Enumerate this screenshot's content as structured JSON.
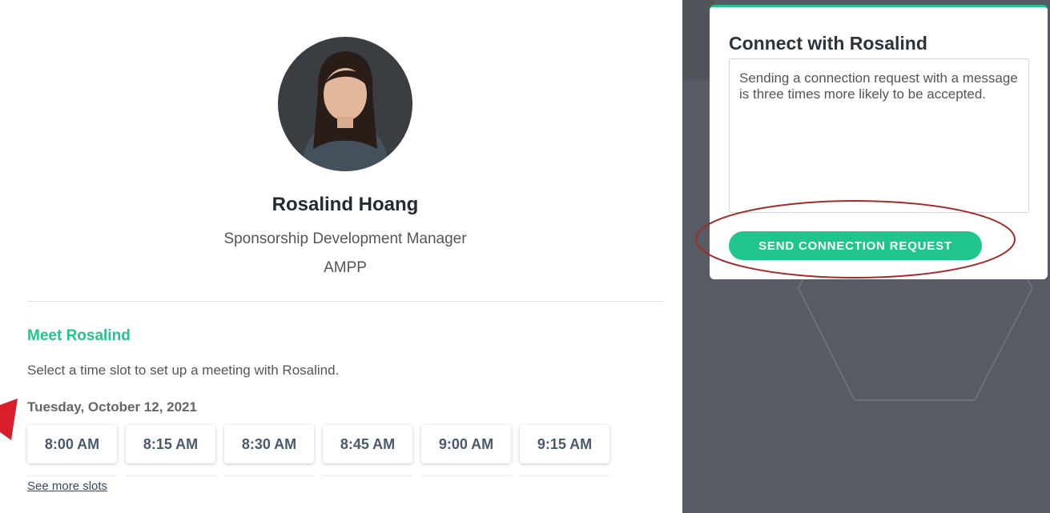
{
  "profile": {
    "name": "Rosalind Hoang",
    "job_title": "Sponsorship Development Manager",
    "company": "AMPP"
  },
  "meet": {
    "heading": "Meet Rosalind",
    "description": "Select a time slot to set up a meeting with Rosalind.",
    "date": "Tuesday, October 12, 2021",
    "slots": [
      "8:00 AM",
      "8:15 AM",
      "8:30 AM",
      "8:45 AM",
      "9:00 AM",
      "9:15 AM"
    ],
    "see_more": "See more slots"
  },
  "connect": {
    "title": "Connect with Rosalind",
    "message_placeholder": "Sending a connection request with a message is three times more likely to be accepted.",
    "send_button": "SEND CONNECTION REQUEST"
  },
  "colors": {
    "accent": "#1fc58a",
    "background_dark": "#575b63",
    "annotation_red": "#b01e2a"
  }
}
